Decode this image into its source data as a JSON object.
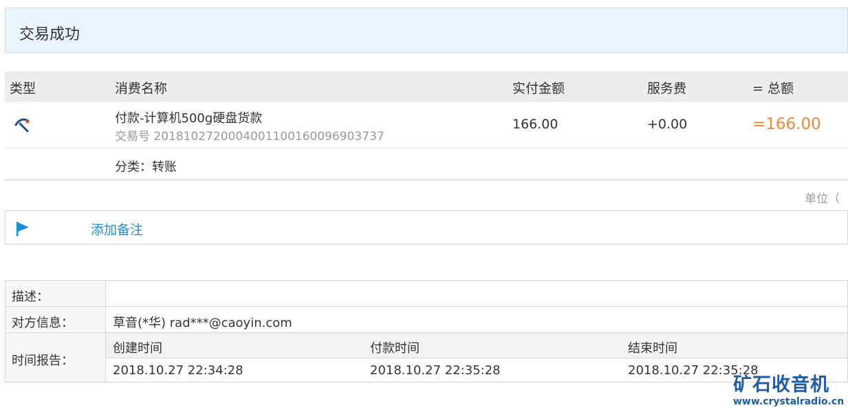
{
  "status": {
    "title": "交易成功"
  },
  "table_header": {
    "type": "类型",
    "name": "消费名称",
    "paid": "实付金额",
    "fee": "服务费",
    "total": "= 总额"
  },
  "transaction": {
    "name": "付款-计算机500g硬盘货款",
    "number": "交易号 2018102720004001100160096903737",
    "amount": "166.00",
    "fee": "+0.00",
    "total": "=166.00",
    "category": "分类：转账"
  },
  "unit_label": "单位（",
  "memo": {
    "link_label": "添加备注"
  },
  "details": {
    "description_label": "描述：",
    "description_value": "",
    "counterparty_label": "对方信息：",
    "counterparty_value": "草音(*华) rad***@caoyin.com",
    "time_label": "时间报告：",
    "created_label": "创建时间",
    "paid_label": "付款时间",
    "ended_label": "结束时间",
    "created_value": "2018.10.27 22:34:28",
    "paid_value": "2018.10.27 22:35:28",
    "ended_value": "2018.10.27 22:35:28"
  },
  "watermark": {
    "title": "矿石收音机",
    "url": "www.crystalradio.cn"
  },
  "colors": {
    "accent_link": "#1a8fd8",
    "total_orange": "#f0883a",
    "status_bg": "#eaf4fc",
    "watermark_blue": "#1f5ca6"
  },
  "icons": {
    "type": "payment-type-icon",
    "memo": "flag-icon"
  }
}
